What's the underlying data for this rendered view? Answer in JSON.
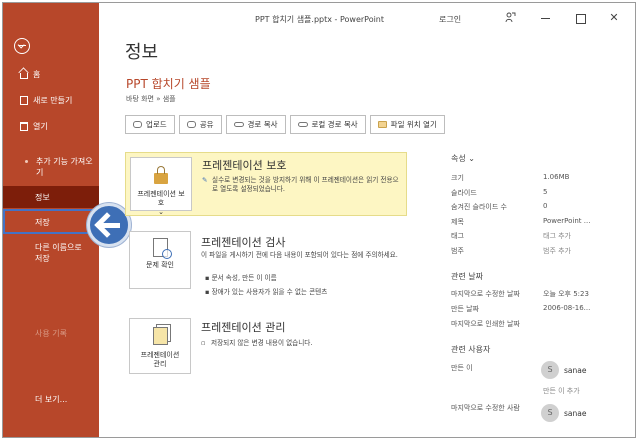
{
  "window": {
    "title": "PPT 합치기 샘플.pptx  -  PowerPoint",
    "signin": "로그인",
    "minimize": "—",
    "maximize": "□",
    "close": "✕"
  },
  "sidebar": {
    "back_icon": "back-arrow-circle-icon",
    "home": "홈",
    "new": "새로 만들기",
    "open": "열기",
    "addins": "추가 기능 가져오기",
    "info": "정보",
    "save": "저장",
    "save_as": "다른 이름으로 저장",
    "history": "사용 기록",
    "more": "더 보기..."
  },
  "main": {
    "page_title": "정보",
    "doc_title": "PPT 합치기 샘플",
    "doc_path": "바탕 화면 » 샘플",
    "actions": {
      "upload": "업로드",
      "share": "공유",
      "copy_path": "경로 복사",
      "copy_local_path": "로컬 경로 복사",
      "open_location": "파일 위치 열기"
    },
    "protect": {
      "button": "프레젠테이션 보호",
      "heading": "프레젠테이션 보호",
      "text": "실수로 변경되는 것을 방지하기 위해 이 프레젠테이션은 읽기 전용으로 열도록 설정되었습니다."
    },
    "inspect": {
      "button": "문제 확인",
      "heading": "프레젠테이션 검사",
      "text": "이 파일을 게시하기 전에 다음 내용이 포함되어 있다는 점에 주의하세요.",
      "bullets": [
        "문서 속성, 만든 이 이름",
        "장애가 있는 사용자가 읽을 수 없는 콘텐츠"
      ]
    },
    "manage": {
      "button": "프레젠테이션 관리",
      "heading": "프레젠테이션 관리",
      "text": "저장되지 않은 변경 내용이 없습니다."
    }
  },
  "properties": {
    "heading": "속성",
    "rows": [
      {
        "k": "크기",
        "v": "1.06MB"
      },
      {
        "k": "슬라이드",
        "v": "5"
      },
      {
        "k": "숨겨진 슬라이드 수",
        "v": "0"
      },
      {
        "k": "제목",
        "v": "PowerPoint ..."
      },
      {
        "k": "태그",
        "v": "태그 추가"
      },
      {
        "k": "범주",
        "v": "범주 추가"
      }
    ],
    "dates_heading": "관련 날짜",
    "dates": [
      {
        "k": "마지막으로 수정한 날짜",
        "v": "오늘 오후 5:23"
      },
      {
        "k": "만든 날짜",
        "v": "2006-08-16..."
      },
      {
        "k": "마지막으로 인쇄한 날짜",
        "v": ""
      }
    ],
    "people_heading": "관련 사용자",
    "author_label": "만든 이",
    "author_name": "sanae",
    "author_initial": "S",
    "add_author": "만든 이 추가",
    "modified_by_label": "마지막으로 수정한 사람",
    "modified_by_name": "sanae",
    "modified_by_initial": "S"
  }
}
